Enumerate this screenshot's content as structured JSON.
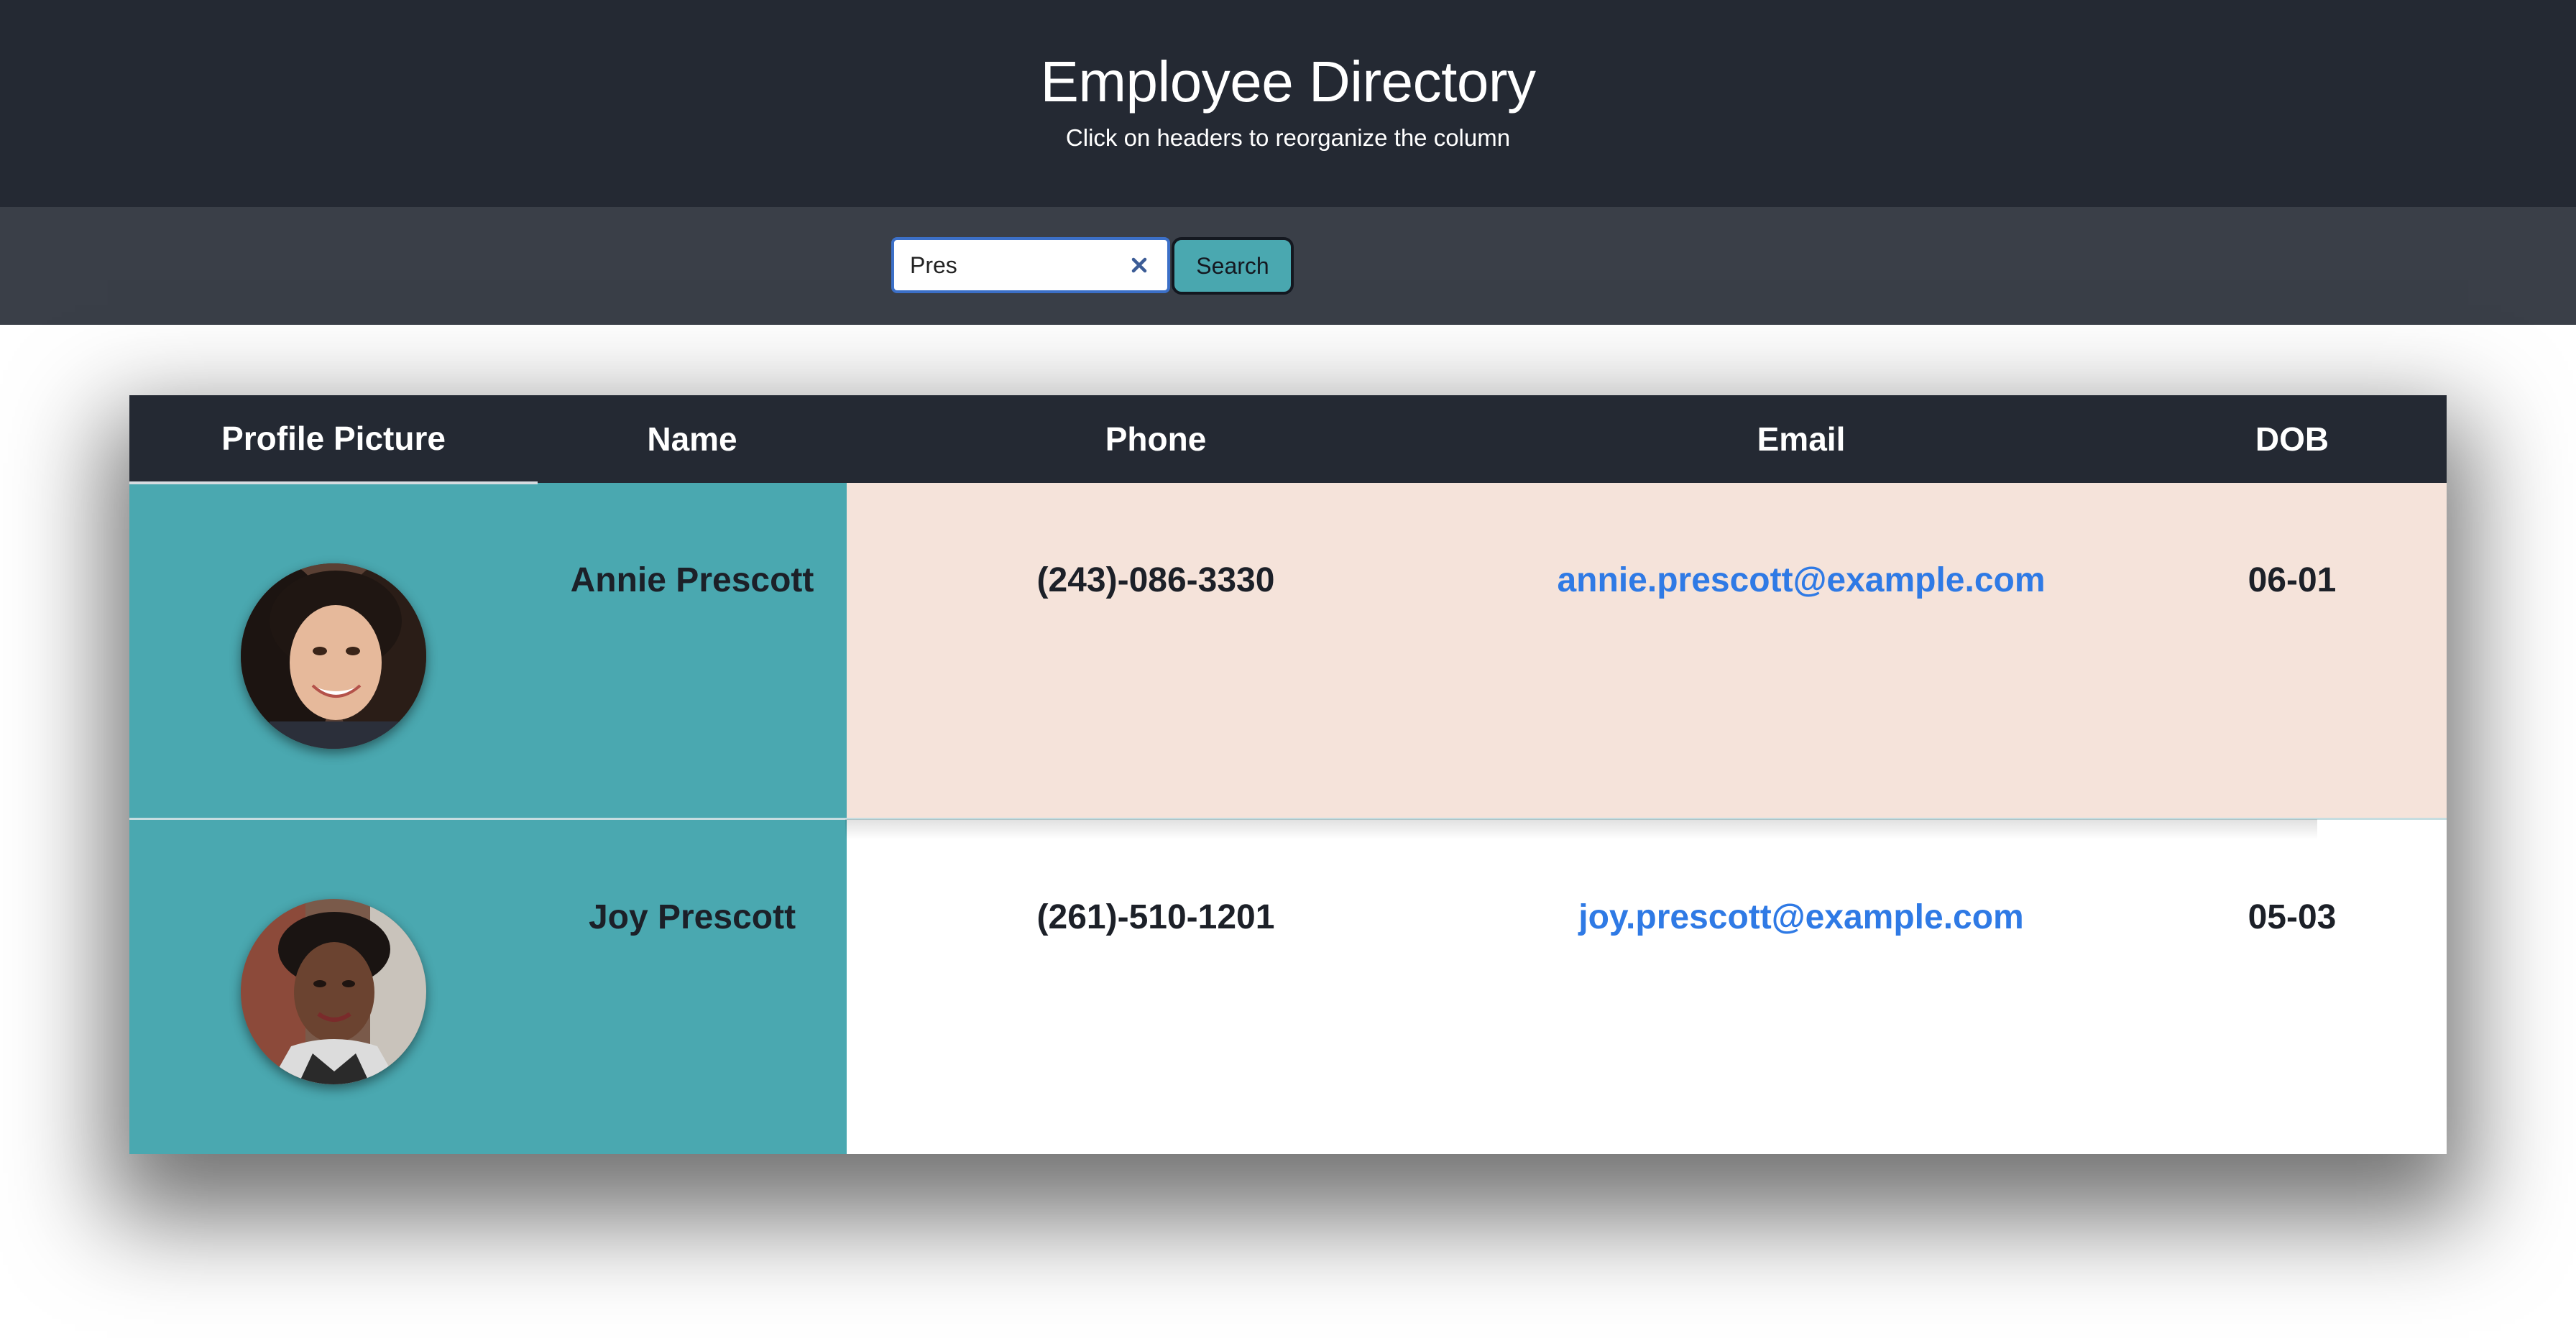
{
  "header": {
    "title": "Employee Directory",
    "subtitle": "Click on headers to reorganize the column"
  },
  "search": {
    "value": "Pres",
    "placeholder": "",
    "button_label": "Search",
    "clear_icon": "close-icon"
  },
  "table": {
    "columns": [
      "Profile Picture",
      "Name",
      "Phone",
      "Email",
      "DOB"
    ],
    "rows": [
      {
        "avatar": "profile-photo",
        "name": "Annie Prescott",
        "phone": "(243)-086-3330",
        "email": "annie.prescott@example.com",
        "dob": "06-01"
      },
      {
        "avatar": "profile-photo",
        "name": "Joy Prescott",
        "phone": "(261)-510-1201",
        "email": "joy.prescott@example.com",
        "dob": "05-03"
      }
    ]
  },
  "colors": {
    "header_bg": "#242933",
    "searchbar_bg": "#3a3f48",
    "accent_teal": "#4aa8b0",
    "highlight_row": "#f5e3da",
    "link": "#2f7ae5"
  }
}
